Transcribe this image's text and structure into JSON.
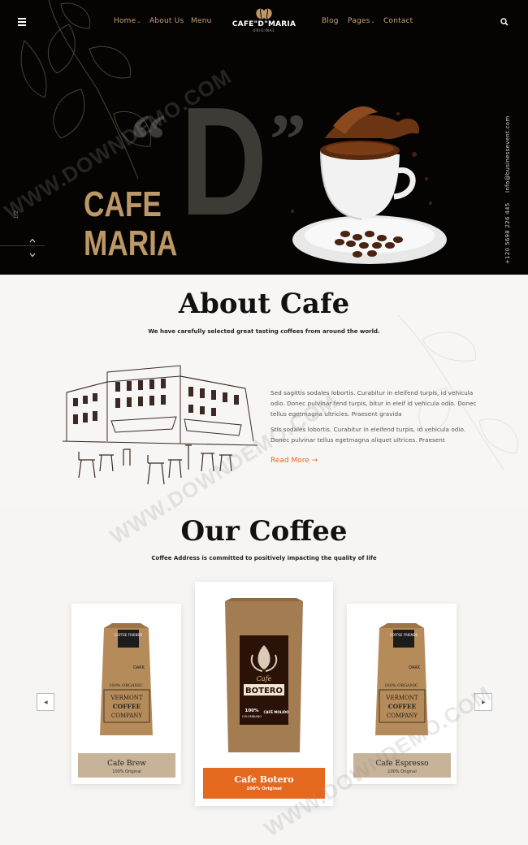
{
  "nav": {
    "left": [
      {
        "label": "Home",
        "dropdown": true
      },
      {
        "label": "About Us",
        "dropdown": false
      },
      {
        "label": "Menu",
        "dropdown": false
      }
    ],
    "right": [
      {
        "label": "Blog",
        "dropdown": false
      },
      {
        "label": "Pages",
        "dropdown": true
      },
      {
        "label": "Contact",
        "dropdown": false
      }
    ],
    "logo": {
      "name": "CAFE\"D\"MARIA",
      "sub": "ORIGINAL"
    }
  },
  "hero": {
    "big_letter": "D",
    "title_line1": "CAFE",
    "title_line2": "MARIA",
    "slide_counter": "1/2",
    "email": "Info@businessevent.com",
    "phone": "+120 5698 226 445"
  },
  "about": {
    "heading": "About Cafe",
    "subheading": "We have carefully selected great tasting coffees from around the world.",
    "paragraph1": "Sed sagittis sodales lobortis. Curabitur in eleifend turpis, id vehicula odio. Donec pulvinar fend turpis, bitur in eleif id vehicula odio. Donec tellus egetmagna ultricies. Praesent gravida",
    "paragraph2": "Stis sodales lobortis. Curabitur in eleifend turpis, id vehicula odio. Donec pulvinar tellus egetmagna aliquet ultrices. Praesent",
    "read_more": "Read More →"
  },
  "coffee": {
    "heading": "Our Coffee",
    "subheading": "Coffee Address is committed to positively impacting the quality of life",
    "products": [
      {
        "name": "Cafe Brew",
        "tag": "100% Original"
      },
      {
        "name": "Cafe Botero",
        "tag": "100% Original"
      },
      {
        "name": "Cafe Espresso",
        "tag": "100% Original"
      }
    ],
    "bag_vermont": {
      "top": "COFFEE FRIENDS",
      "l1": "100% ORGANIC",
      "l2": "VERMONT",
      "l3": "COFFEE",
      "l4": "COMPANY",
      "dark": "DARK"
    },
    "bag_botero": {
      "top": "Cafe",
      "name": "BOTERO",
      "l1": "100%",
      "l2": "COLOMBIANO",
      "l3": "CAFÉ MOLIDO"
    }
  },
  "watermark": "WWW.DOWNDEMO.COM",
  "colors": {
    "gold": "#bb9866",
    "accent": "#e4691e",
    "tan": "#c7b398",
    "hero_bg": "#060403"
  }
}
